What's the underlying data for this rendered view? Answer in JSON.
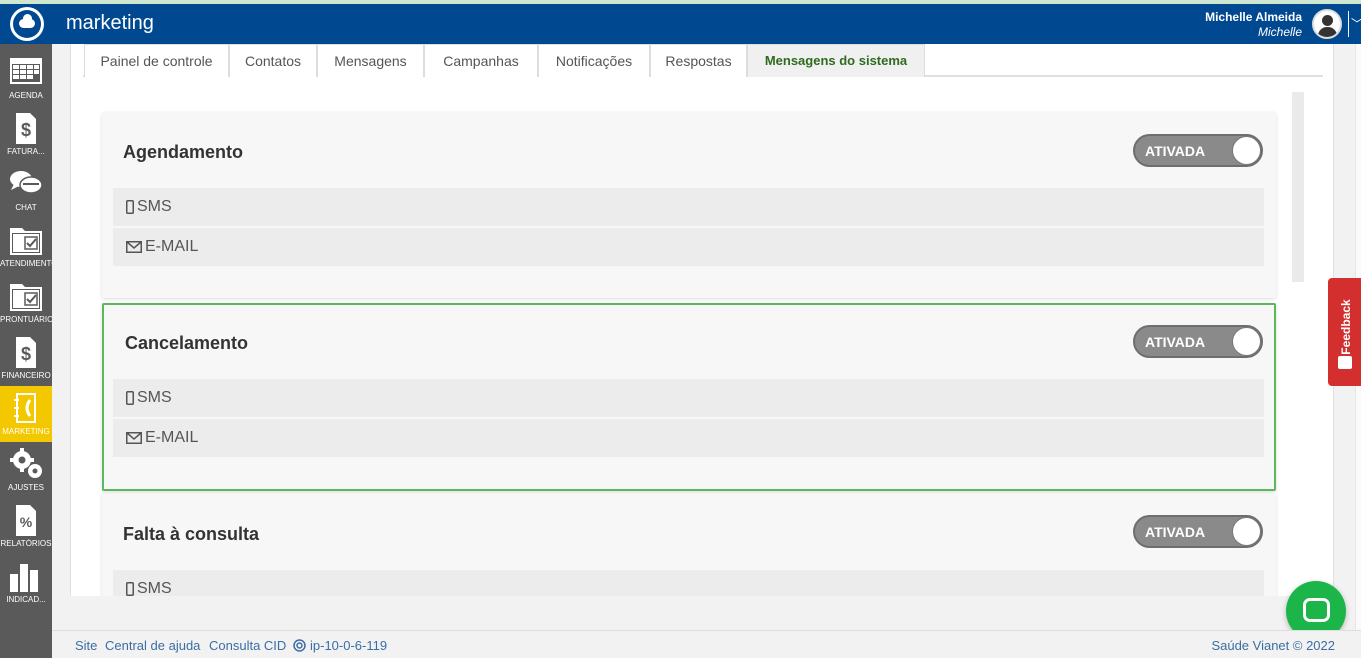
{
  "header": {
    "app_title": "marketing",
    "user_name": "Michelle Almeida",
    "user_login": "Michelle"
  },
  "sidebar": {
    "items": [
      {
        "label": "AGENDA",
        "icon": "calendar-icon"
      },
      {
        "label": "FATURA...",
        "icon": "dollar-document-icon"
      },
      {
        "label": "CHAT",
        "icon": "chat-icon"
      },
      {
        "label": "ATENDIMENTO",
        "icon": "folder-check-icon"
      },
      {
        "label": "PRONTUÁRIO",
        "icon": "folder-check-icon"
      },
      {
        "label": "FINANCEIRO",
        "icon": "dollar-document-icon"
      },
      {
        "label": "MARKETING",
        "icon": "phone-book-icon"
      },
      {
        "label": "AJUSTES",
        "icon": "gears-icon"
      },
      {
        "label": "RELATÓRIOS",
        "icon": "percent-document-icon"
      },
      {
        "label": "INDICAD...",
        "icon": "bar-chart-icon"
      }
    ],
    "active_color": "#f4c800"
  },
  "tabs": [
    {
      "label": "Painel de controle"
    },
    {
      "label": "Contatos"
    },
    {
      "label": "Mensagens"
    },
    {
      "label": "Campanhas"
    },
    {
      "label": "Notificações"
    },
    {
      "label": "Respostas"
    },
    {
      "label": "Mensagens do sistema"
    }
  ],
  "cards": [
    {
      "title": "Agendamento",
      "toggle": "ATIVADA",
      "rows": [
        {
          "label": "SMS"
        },
        {
          "label": "E-MAIL"
        }
      ]
    },
    {
      "title": "Cancelamento",
      "toggle": "ATIVADA",
      "rows": [
        {
          "label": "SMS"
        },
        {
          "label": "E-MAIL"
        }
      ]
    },
    {
      "title": "Falta à consulta",
      "toggle": "ATIVADA",
      "rows": [
        {
          "label": "SMS"
        }
      ]
    }
  ],
  "feedback": {
    "label": "Feedback"
  },
  "footer": {
    "links": [
      "Site",
      "Central de ajuda",
      "Consulta CID",
      "ip-10-0-6-119"
    ],
    "copyright": "Saúde Vianet © 2022"
  },
  "colors": {
    "header_bg": "#004990",
    "selected_border": "#5cb85c",
    "feedback_bg": "#d32f2f",
    "chat_bg": "#1cb54a"
  }
}
